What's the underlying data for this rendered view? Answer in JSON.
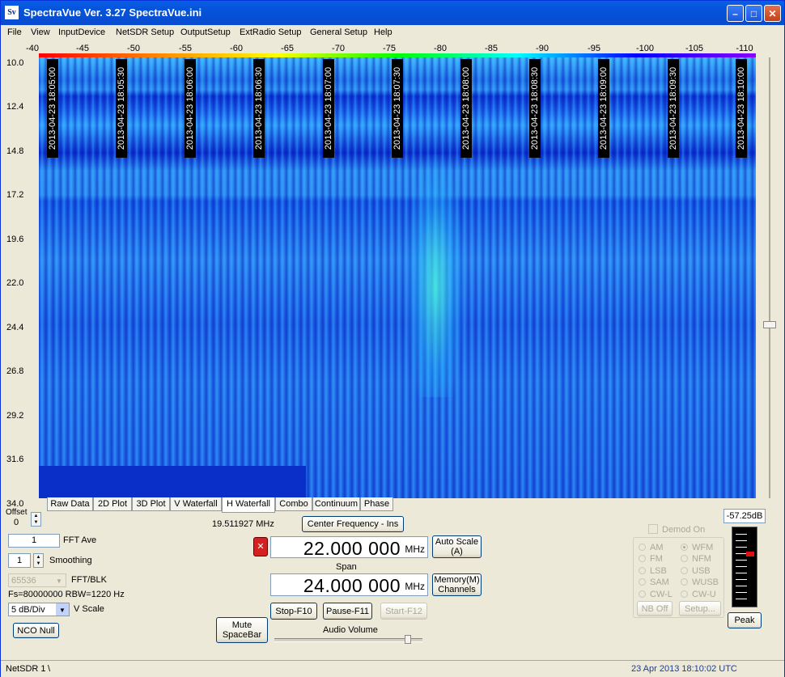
{
  "window": {
    "title": "SpectraVue Ver. 3.27  SpectraVue.ini",
    "icon_label": "Sv"
  },
  "menu": [
    "File",
    "View",
    "InputDevice",
    "NetSDR Setup",
    "OutputSetup",
    "ExtRadio Setup",
    "General Setup",
    "Help"
  ],
  "db_axis": [
    "-40",
    "-45",
    "-50",
    "-55",
    "-60",
    "-65",
    "-70",
    "-75",
    "-80",
    "-85",
    "-90",
    "-95",
    "-100",
    "-105",
    "-110"
  ],
  "freq_axis": [
    "10.0",
    "12.4",
    "14.8",
    "17.2",
    "19.6",
    "22.0",
    "24.4",
    "26.8",
    "29.2",
    "31.6",
    "34.0"
  ],
  "timestamps": [
    "2013-04-23 18:05:00",
    "2013-04-23 18:05:30",
    "2013-04-23 18:06:00",
    "2013-04-23 18:06:30",
    "2013-04-23 18:07:00",
    "2013-04-23 18:07:30",
    "2013-04-23 18:08:00",
    "2013-04-23 18:08:30",
    "2013-04-23 18:09:00",
    "2013-04-23 18:09:30",
    "2013-04-23 18:10:00"
  ],
  "tabs": [
    "Raw Data",
    "2D Plot",
    "3D Plot",
    "V Waterfall",
    "H Waterfall",
    "Combo",
    "Continuum",
    "Phase"
  ],
  "active_tab": "H Waterfall",
  "controls": {
    "offset_label": "Offset",
    "offset_value": "0",
    "fft_ave_value": "1",
    "fft_ave_label": "FFT Ave",
    "smoothing_value": "1",
    "smoothing_label": "Smoothing",
    "fft_blk_value": "65536",
    "fft_blk_label": "FFT/BLK",
    "fs_info": "Fs=80000000 RBW=1220 Hz",
    "vscale_value": "5 dB/Div",
    "vscale_label": "V Scale",
    "nco_null": "NCO Null",
    "cursor_freq": "19.511927 MHz",
    "center_freq_button": "Center Frequency - Ins",
    "center_freq_value": "22.000 000",
    "center_freq_unit": "MHz",
    "auto_scale": "Auto Scale\n(A)",
    "span_label": "Span",
    "span_value": "24.000 000",
    "span_unit": "MHz",
    "memory_channels": "Memory(M)\nChannels",
    "stop": "Stop-F10",
    "pause": "Pause-F11",
    "start": "Start-F12",
    "mute": "Mute\nSpaceBar",
    "audio_volume": "Audio Volume",
    "audio_volume_level": 0.92,
    "demod_on": "Demod On",
    "demod_left": [
      "AM",
      "FM",
      "LSB",
      "SAM",
      "CW-L"
    ],
    "demod_right": [
      "WFM",
      "NFM",
      "USB",
      "WUSB",
      "CW-U"
    ],
    "demod_selected": "WFM",
    "nb_off": "NB Off",
    "setup": "Setup...",
    "peak_value": "-57.25dB",
    "peak_button": "Peak"
  },
  "status": {
    "left": "NetSDR 1",
    "sep": "\\",
    "right": "23 Apr 2013  18:10:02 UTC",
    "right_color": "#1a3c9c"
  }
}
